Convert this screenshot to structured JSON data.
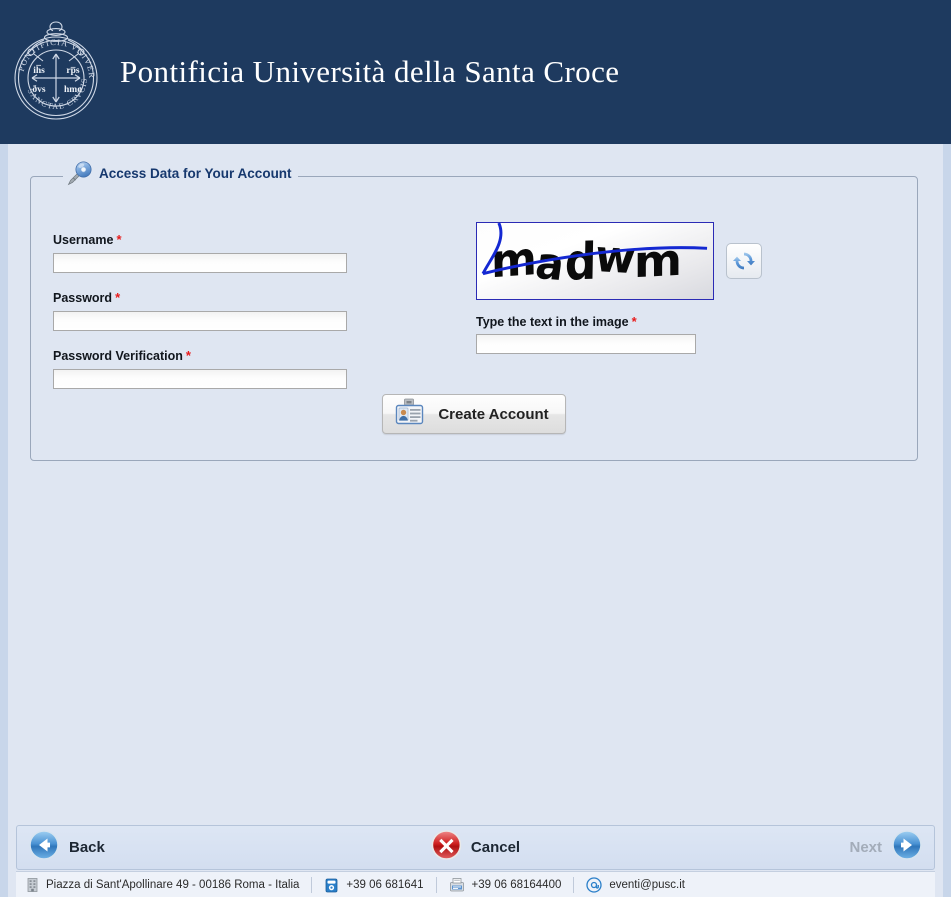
{
  "header": {
    "title": "Pontificia Università della Santa Croce",
    "crest_alt": "university-crest",
    "crest_text_top": "PONTIFICIA VNIVERSITAS",
    "crest_text_bottom": "SANCTAE CRVCIS",
    "background_color": "#1e3a5f"
  },
  "panel": {
    "legend": "Access Data for Your Account",
    "legend_icon": "key-icon"
  },
  "form": {
    "username": {
      "label": "Username",
      "required_marker": "*",
      "value": "",
      "placeholder": ""
    },
    "password": {
      "label": "Password",
      "required_marker": "*",
      "value": "",
      "placeholder": ""
    },
    "password_verification": {
      "label": "Password Verification",
      "required_marker": "*",
      "value": "",
      "placeholder": ""
    }
  },
  "captcha": {
    "image_text": "madwm",
    "letters": [
      "m",
      "a",
      "d",
      "w",
      "m"
    ],
    "refresh_icon": "refresh-icon",
    "label": "Type the text in the image",
    "required_marker": "*",
    "value": "",
    "placeholder": ""
  },
  "actions": {
    "create_account": {
      "label": "Create Account",
      "icon": "id-card-icon"
    }
  },
  "nav": {
    "back": {
      "label": "Back",
      "icon": "arrow-left-icon",
      "disabled": false
    },
    "cancel": {
      "label": "Cancel",
      "icon": "cancel-icon",
      "disabled": false
    },
    "next": {
      "label": "Next",
      "icon": "arrow-right-icon",
      "disabled": true
    }
  },
  "contact": {
    "address": "Piazza di Sant'Apollinare 49 - 00186 Roma - Italia",
    "address_icon": "building-icon",
    "phone": "+39 06 681641",
    "phone_icon": "telephone-icon",
    "fax": "+39 06 68164400",
    "fax_icon": "fax-icon",
    "email": "eventi@pusc.it",
    "email_icon": "at-sign-icon"
  },
  "colors": {
    "header_navy": "#1e3a5f",
    "page_background": "#dfe6f2",
    "legend_blue": "#16386e",
    "required_red": "#e81b1b",
    "accent_blue": "#4a90d9"
  }
}
